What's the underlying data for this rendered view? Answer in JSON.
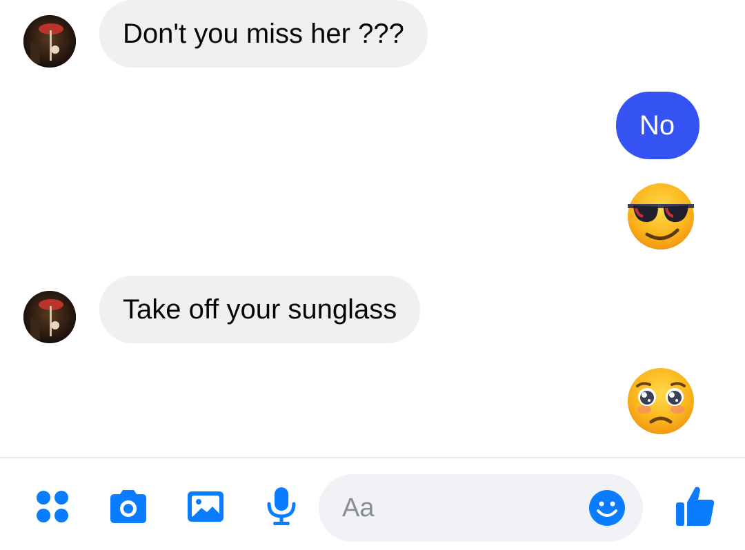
{
  "colors": {
    "accent": "#0a7cff",
    "outgoing_bubble": "#3552f2",
    "incoming_bubble": "#f0f0f0"
  },
  "messages": [
    {
      "direction": "incoming",
      "type": "text",
      "text": "Don't you miss her ???"
    },
    {
      "direction": "outgoing",
      "type": "text",
      "text": "No"
    },
    {
      "direction": "outgoing",
      "type": "emoji",
      "emoji": "smiling-face-with-sunglasses"
    },
    {
      "direction": "incoming",
      "type": "text",
      "text": "Take off your sunglass"
    },
    {
      "direction": "outgoing",
      "type": "emoji",
      "emoji": "pleading-face"
    }
  ],
  "composer": {
    "placeholder": "Aa"
  },
  "toolbar": {
    "icons": [
      "menu-dots-icon",
      "camera-icon",
      "gallery-icon",
      "microphone-icon",
      "emoji-icon",
      "like-icon"
    ]
  }
}
